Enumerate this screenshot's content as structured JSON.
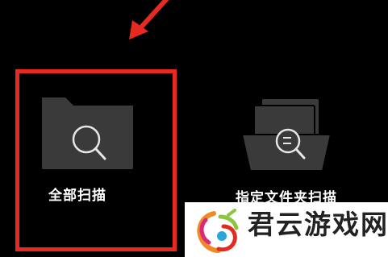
{
  "colors": {
    "background": "#000000",
    "highlight": "#e62a1f",
    "icon_fill": "#3a3a3a",
    "icon_line": "#e6e6e6",
    "label": "#ffffff"
  },
  "annotation": {
    "arrow_icon": "red-arrow-icon"
  },
  "scan_options": [
    {
      "label": "全部扫描",
      "icon": "folder-search-icon",
      "highlighted": true
    },
    {
      "label": "指定文件夹扫描",
      "icon": "folder-document-search-icon",
      "highlighted": false
    }
  ],
  "watermark": {
    "title": "君云游戏网",
    "logo_icon": "colorful-logo-icon"
  }
}
